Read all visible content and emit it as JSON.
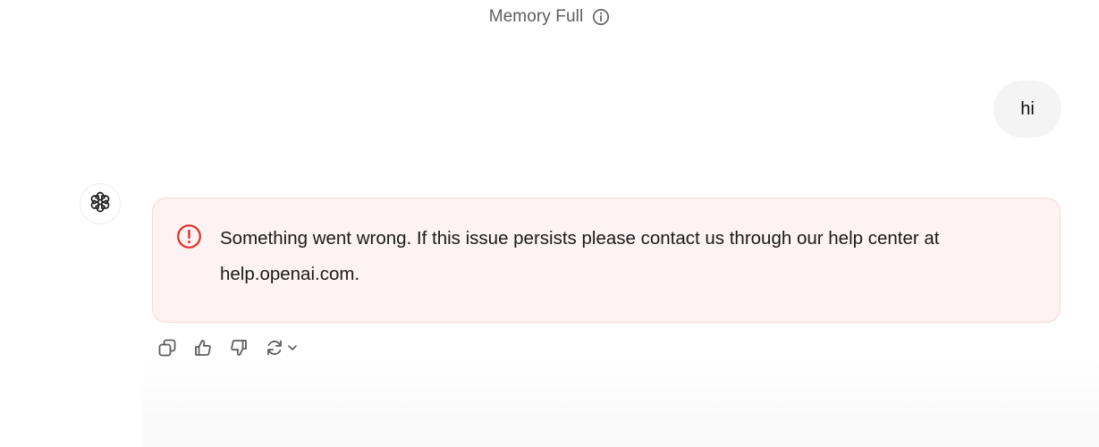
{
  "header": {
    "title": "Memory Full",
    "info_icon": "info-circle-icon"
  },
  "conversation": {
    "user_message": "hi",
    "assistant_avatar_icon": "openai-logo-icon",
    "error": {
      "icon": "alert-circle-icon",
      "message": "Something went wrong. If this issue persists please contact us through our help center at help.openai.com.",
      "color": "#e02e2a"
    }
  },
  "actions": [
    {
      "icon": "copy-icon"
    },
    {
      "icon": "thumbs-up-icon"
    },
    {
      "icon": "thumbs-down-icon"
    },
    {
      "icon": "regenerate-icon"
    }
  ]
}
